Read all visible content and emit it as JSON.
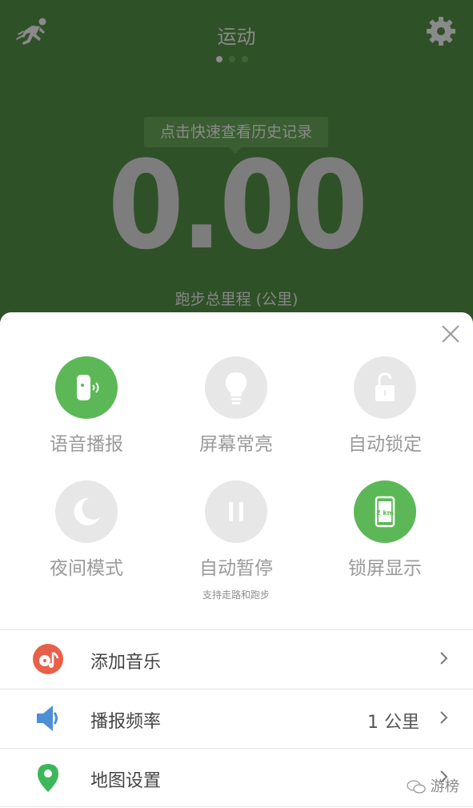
{
  "header": {
    "title": "运动",
    "runner_icon": "runner-icon",
    "settings_icon": "gear-icon",
    "page_indicator": {
      "count": 3,
      "active_index": 0
    }
  },
  "stats": {
    "history_tip": "点击快速查看历史记录",
    "distance": "0.00",
    "distance_label": "跑步总里程 (公里)"
  },
  "panel": {
    "close_icon": "close-icon",
    "toggles": [
      {
        "label": "语音播报",
        "icon": "voice-icon",
        "on": true
      },
      {
        "label": "屏幕常亮",
        "icon": "bulb-icon",
        "on": false
      },
      {
        "label": "自动锁定",
        "icon": "unlock-icon",
        "on": false
      },
      {
        "label": "夜间模式",
        "icon": "moon-icon",
        "on": false
      },
      {
        "label": "自动暂停",
        "icon": "pause-icon",
        "on": false,
        "sub": "支持走路和跑步"
      },
      {
        "label": "锁屏显示",
        "icon": "phone-icon",
        "on": true,
        "badge": "2 km"
      }
    ],
    "menu": [
      {
        "label": "添加音乐",
        "icon": "music-icon",
        "value": ""
      },
      {
        "label": "播报频率",
        "icon": "speaker-icon",
        "value": "1 公里"
      },
      {
        "label": "地图设置",
        "icon": "map-pin-icon",
        "value": ""
      }
    ]
  },
  "watermark": {
    "text": "游榜",
    "icon": "wechat-icon"
  },
  "colors": {
    "header_bg": "#2f5127",
    "accent_green": "#5cb856",
    "toggle_off": "#e7e7e7",
    "music_red": "#e8604a",
    "speaker_blue": "#4d8fd6",
    "pin_green": "#3cb85a"
  }
}
